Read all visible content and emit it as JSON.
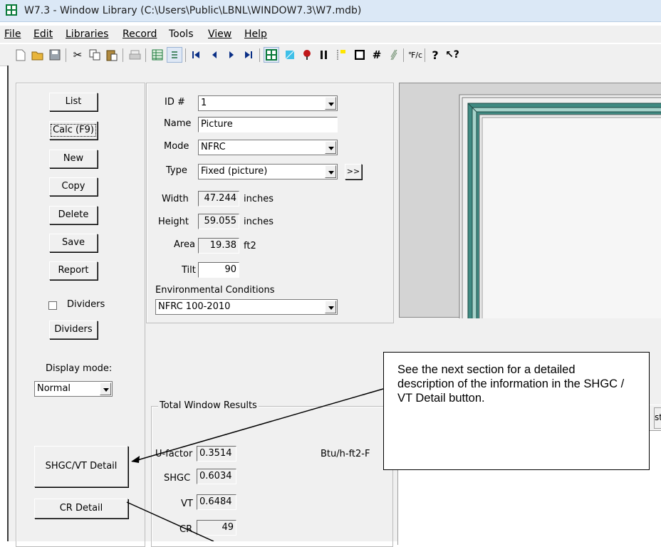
{
  "window": {
    "title": "W7.3 - Window Library (C:\\Users\\Public\\LBNL\\WINDOW7.3\\W7.mdb)"
  },
  "menubar": {
    "items": [
      {
        "label": "File"
      },
      {
        "label": "Edit"
      },
      {
        "label": "Libraries"
      },
      {
        "label": "Record"
      },
      {
        "label": "Tools"
      },
      {
        "label": "View"
      },
      {
        "label": "Help"
      }
    ]
  },
  "toolbar": {
    "icons": [
      "new-file-icon",
      "open-folder-icon",
      "save-disk-icon",
      "cut-icon",
      "copy-icon",
      "paste-icon",
      "print-icon",
      "grid-view-icon",
      "list-view-icon",
      "first-record-icon",
      "prev-record-icon",
      "next-record-icon",
      "last-record-icon",
      "window-library-icon",
      "glazing-icon",
      "gas-icon",
      "frame-icon",
      "divider-icon",
      "shading-icon",
      "thermal-icon",
      "spectral-icon",
      "units-toggle-icon",
      "help-icon",
      "context-help-icon"
    ]
  },
  "sidebar": {
    "buttons": {
      "list": "List",
      "calc": "Calc (F9)",
      "new": "New",
      "copy": "Copy",
      "delete": "Delete",
      "save": "Save",
      "report": "Report"
    },
    "dividers_checkbox_label": "Dividers",
    "dividers_checked": false,
    "dividers_button": "Dividers",
    "display_mode_label": "Display mode:",
    "display_mode_value": "Normal",
    "shgc_vt_button": "SHGC/VT Detail",
    "cr_button": "CR Detail"
  },
  "form": {
    "id_label": "ID #",
    "id_value": "1",
    "name_label": "Name",
    "name_value": "Picture",
    "mode_label": "Mode",
    "mode_value": "NFRC",
    "type_label": "Type",
    "type_value": "Fixed (picture)",
    "type_more_button": ">>",
    "width_label": "Width",
    "width_value": "47.244",
    "width_unit": "inches",
    "height_label": "Height",
    "height_value": "59.055",
    "height_unit": "inches",
    "area_label": "Area",
    "area_value": "19.38",
    "area_unit": "ft2",
    "tilt_label": "Tilt",
    "tilt_value": "90",
    "env_label": "Environmental Conditions",
    "env_value": "NFRC 100-2010"
  },
  "results": {
    "group_title": "Total Window Results",
    "ufactor_label": "U-factor",
    "ufactor_value": "0.3514",
    "ufactor_unit": "Btu/h-ft2-F",
    "shgc_label": "SHGC",
    "shgc_value": "0.6034",
    "vt_label": "VT",
    "vt_value": "0.6484",
    "cr_label": "CR",
    "cr_value": "49"
  },
  "right_panel": {
    "partial_tab_text": "stic"
  },
  "callout": {
    "text": "See the next section for  a detailed description of the information in the SHGC / VT Detail button."
  },
  "colors": {
    "frame_outer": "#3f8a82",
    "frame_inner": "#a7d4cc",
    "preview_bg": "#d4d4d4",
    "chrome": "#f0f0f0"
  }
}
